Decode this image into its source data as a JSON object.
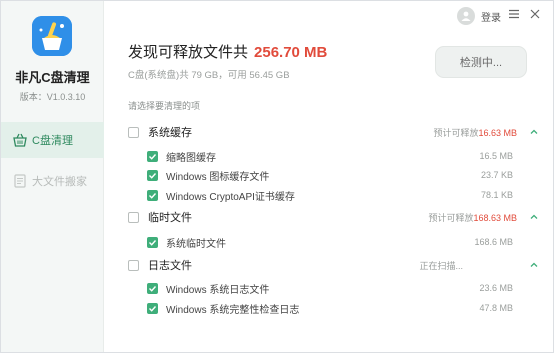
{
  "app": {
    "name": "非凡C盘清理",
    "version": "版本：V1.0.3.10"
  },
  "sidebar": {
    "items": [
      {
        "label": "C盘清理",
        "icon": "basket-icon",
        "active": true
      },
      {
        "label": "大文件搬家",
        "icon": "document-icon",
        "active": false
      }
    ]
  },
  "topbar": {
    "login_label": "登录",
    "menu_icon": "hamburger-icon",
    "close_icon": "close-icon"
  },
  "header": {
    "title_prefix": "发现可释放文件共",
    "total_size": "256.70 MB",
    "disk_info": "C盘(系统盘)共 79 GB，可用 56.45 GB",
    "detect_button": "检测中..."
  },
  "hint": "请选择要清理的项",
  "groups": [
    {
      "label": "系统缓存",
      "status_prefix": "预计可释放",
      "status_value": "16.63 MB",
      "items": [
        {
          "label": "缩略图缓存",
          "size": "16.5 MB"
        },
        {
          "label": "Windows 图标缓存文件",
          "size": "23.7 KB"
        },
        {
          "label": "Windows CryptoAPI证书缓存",
          "size": "78.1 KB"
        }
      ]
    },
    {
      "label": "临时文件",
      "status_prefix": "预计可释放",
      "status_value": "168.63 MB",
      "items": [
        {
          "label": "系统临时文件",
          "size": "168.6 MB"
        }
      ]
    },
    {
      "label": "日志文件",
      "status_prefix": "正在扫描...",
      "status_value": "",
      "items": [
        {
          "label": "Windows 系统日志文件",
          "size": "23.6 MB"
        },
        {
          "label": "Windows 系统完整性检查日志",
          "size": "47.8 MB"
        }
      ]
    }
  ],
  "colors": {
    "accent_green": "#3fae7a",
    "highlight_red": "#e14b3b",
    "logo_blue": "#2f8fe8"
  }
}
